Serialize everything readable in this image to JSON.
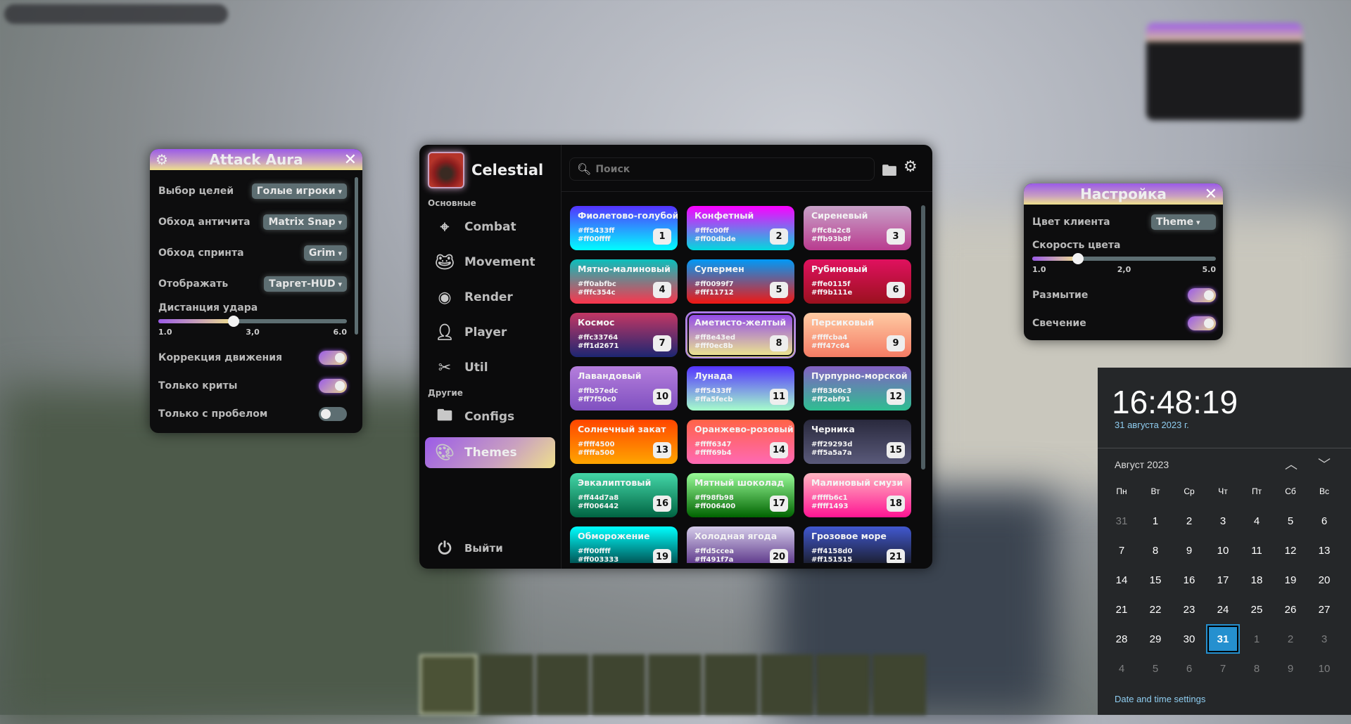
{
  "colors": {
    "accent_start": "#9b5be8",
    "accent_end": "#efe08c",
    "panel_bg": "#0d0d0e",
    "calendar_today": "#2590cf"
  },
  "attack_aura": {
    "title": "Attack Aura",
    "settings_icon": "gear-icon",
    "close_icon": "close-icon",
    "dropdowns": [
      {
        "label": "Выбор целей",
        "value": "Голые игроки"
      },
      {
        "label": "Обход античита",
        "value": "Matrix Snap"
      },
      {
        "label": "Обход спринта",
        "value": "Grim"
      },
      {
        "label": "Отображать",
        "value": "Таргет-HUD"
      }
    ],
    "slider": {
      "label": "Дистанция удара",
      "min": "1.0",
      "mid": "3,0",
      "max": "6.0",
      "value": 3.0,
      "fraction": 0.4
    },
    "toggles": [
      {
        "label": "Коррекция движения",
        "on": true
      },
      {
        "label": "Только криты",
        "on": true
      },
      {
        "label": "Только с пробелом",
        "on": false
      }
    ]
  },
  "main": {
    "brand": "Celestial",
    "sections": [
      {
        "title": "Основные"
      },
      {
        "title": "Другие"
      }
    ],
    "sidebar": [
      {
        "label": "Combat",
        "icon": "crosshair-icon"
      },
      {
        "label": "Movement",
        "icon": "frog-icon"
      },
      {
        "label": "Render",
        "icon": "eye-slash-icon"
      },
      {
        "label": "Player",
        "icon": "user-icon"
      },
      {
        "label": "Util",
        "icon": "tools-icon"
      },
      {
        "label": "Configs",
        "icon": "folder-gear-icon"
      },
      {
        "label": "Themes",
        "icon": "palette-icon",
        "active": true
      }
    ],
    "logout": "Выйти",
    "search": {
      "placeholder": "Поиск"
    },
    "themes": [
      {
        "name": "Фиолетово-голубой",
        "c1": "#ff5433ff",
        "c2": "#ff00ffff",
        "n": "1"
      },
      {
        "name": "Конфетный",
        "c1": "#fffc00ff",
        "c2": "#ff00dbde",
        "n": "2"
      },
      {
        "name": "Сиреневый",
        "c1": "#ffc8a2c8",
        "c2": "#ffb93b8f",
        "n": "3"
      },
      {
        "name": "Мятно-малиновый",
        "c1": "#ff0abfbc",
        "c2": "#fffc354c",
        "n": "4"
      },
      {
        "name": "Супермен",
        "c1": "#ff0099f7",
        "c2": "#fff11712",
        "n": "5"
      },
      {
        "name": "Рубиновый",
        "c1": "#ffe0115f",
        "c2": "#ff9b111e",
        "n": "6"
      },
      {
        "name": "Космос",
        "c1": "#ffc33764",
        "c2": "#ff1d2671",
        "n": "7"
      },
      {
        "name": "Аметисто-желтый",
        "c1": "#ff8e43ed",
        "c2": "#fff0ec8b",
        "n": "8",
        "selected": true
      },
      {
        "name": "Персиковый",
        "c1": "#ffffcba4",
        "c2": "#fff47c64",
        "n": "9"
      },
      {
        "name": "Лавандовый",
        "c1": "#ffb57edc",
        "c2": "#ff7f50c0",
        "n": "10"
      },
      {
        "name": "Лунада",
        "c1": "#ff5433ff",
        "c2": "#ffa5fecb",
        "n": "11"
      },
      {
        "name": "Пурпурно-морской",
        "c1": "#ff8360c3",
        "c2": "#ff2ebf91",
        "n": "12"
      },
      {
        "name": "Солнечный закат",
        "c1": "#ffff4500",
        "c2": "#ffffa500",
        "n": "13"
      },
      {
        "name": "Оранжево-розовый",
        "c1": "#ffff6347",
        "c2": "#ffff69b4",
        "n": "14"
      },
      {
        "name": "Черника",
        "c1": "#ff29293d",
        "c2": "#ff5a5a7a",
        "n": "15"
      },
      {
        "name": "Эвкалиптовый",
        "c1": "#ff44d7a8",
        "c2": "#ff006442",
        "n": "16"
      },
      {
        "name": "Мятный шоколад",
        "c1": "#ff98fb98",
        "c2": "#ff006400",
        "n": "17"
      },
      {
        "name": "Малиновый смузи",
        "c1": "#ffffb6c1",
        "c2": "#ffff1493",
        "n": "18"
      },
      {
        "name": "Обморожение",
        "c1": "#ff00ffff",
        "c2": "#ff003333",
        "n": "19"
      },
      {
        "name": "Холодная ягода",
        "c1": "#ffd5ccea",
        "c2": "#ff491f7a",
        "n": "20"
      },
      {
        "name": "Грозовое море",
        "c1": "#ff4158d0",
        "c2": "#ff151515",
        "n": "21"
      }
    ]
  },
  "client_settings": {
    "title": "Настройка",
    "dropdown": {
      "label": "Цвет клиента",
      "value": "Theme"
    },
    "slider": {
      "label": "Скорость цвета",
      "min": "1.0",
      "mid": "2,0",
      "max": "5.0",
      "value": 2.0,
      "fraction": 0.25
    },
    "toggles": [
      {
        "label": "Размытие",
        "on": true
      },
      {
        "label": "Свечение",
        "on": true
      }
    ]
  },
  "calendar": {
    "time": "16:48:19",
    "date": "31 августа 2023 г.",
    "month": "Август 2023",
    "weekdays": [
      "Пн",
      "Вт",
      "Ср",
      "Чт",
      "Пт",
      "Сб",
      "Вс"
    ],
    "days": [
      "31",
      "1",
      "2",
      "3",
      "4",
      "5",
      "6",
      "7",
      "8",
      "9",
      "10",
      "11",
      "12",
      "13",
      "14",
      "15",
      "16",
      "17",
      "18",
      "19",
      "20",
      "21",
      "22",
      "23",
      "24",
      "25",
      "26",
      "27",
      "28",
      "29",
      "30",
      "31",
      "1",
      "2",
      "3",
      "4",
      "5",
      "6",
      "7",
      "8",
      "9",
      "10"
    ],
    "today_index": 31,
    "dim_before": 1,
    "dim_after_index": 32,
    "settings_link": "Date and time settings"
  }
}
